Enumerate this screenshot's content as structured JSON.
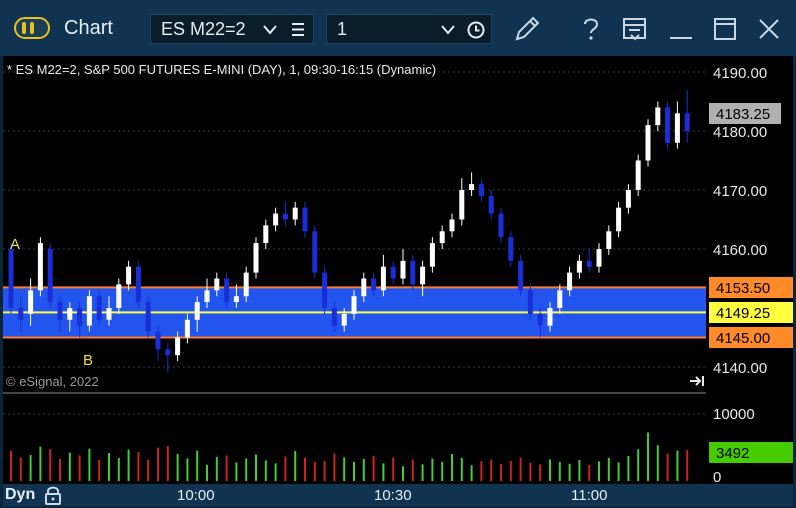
{
  "titlebar": {
    "title": "Chart",
    "symbol": "ES M22=2",
    "interval": "1",
    "icons": [
      "toggle-icon",
      "chevron-down-icon",
      "menu-icon",
      "chevron-down-icon",
      "clock-icon",
      "pencil-icon",
      "help-icon",
      "layout-icon",
      "minimize-icon",
      "maximize-icon",
      "close-icon"
    ],
    "accent_color": "#e8c020"
  },
  "chart": {
    "header": "* ES M22=2, S&P 500 FUTURES E-MINI (DAY), 1, 09:30-16:15 (Dynamic)",
    "copyright": "© eSignal, 2022",
    "annotation_a": "A",
    "annotation_b": "B",
    "price_axis": {
      "labels": [
        "4190.00",
        "4180.00",
        "4170.00",
        "4160.00",
        "4140.00"
      ],
      "last_price": "4183.25",
      "band_top": "4153.50",
      "band_mid": "4149.25",
      "band_bottom": "4145.00"
    },
    "volume_axis": {
      "labels": [
        "10000",
        "0"
      ],
      "last_volume": "3492"
    },
    "colors": {
      "up": "#ffffff",
      "down": "#1a2ed8",
      "band_fill": "#2255ee",
      "band_edge": "#ff7a2a",
      "mid_line": "#ffff40",
      "vol_up": "#44cc33",
      "vol_down": "#cc2222"
    }
  },
  "bottom": {
    "mode": "Dyn",
    "times": [
      "10:00",
      "10:30",
      "11:00"
    ]
  },
  "chart_data": {
    "type": "candlestick",
    "title": "* ES M22=2, S&P 500 FUTURES E-MINI (DAY), 1, 09:30-16:15 (Dynamic)",
    "y_ticks": [
      4140,
      4160,
      4170,
      4180,
      4190
    ],
    "x_ticks": [
      "10:00",
      "10:30",
      "11:00"
    ],
    "band": [
      4145.0,
      4149.25,
      4153.5
    ],
    "last": 4183.25,
    "last_volume": 3492,
    "series": [
      {
        "name": "price",
        "points": [
          [
            4160,
            4150,
            4161,
            4149
          ],
          [
            4150,
            4148,
            4152,
            4146
          ],
          [
            4149,
            4153,
            4155,
            4147
          ],
          [
            4153,
            4161,
            4162,
            4152
          ],
          [
            4160,
            4151,
            4161,
            4150
          ],
          [
            4151,
            4148,
            4152,
            4146
          ],
          [
            4148,
            4150,
            4151,
            4146
          ],
          [
            4150,
            4147,
            4151,
            4145
          ],
          [
            4147,
            4152,
            4153,
            4146
          ],
          [
            4152,
            4148,
            4153,
            4147
          ],
          [
            4148,
            4150,
            4152,
            4147
          ],
          [
            4150,
            4154,
            4155,
            4149
          ],
          [
            4154,
            4157,
            4158,
            4153
          ],
          [
            4157,
            4151,
            4158,
            4150
          ],
          [
            4151,
            4146,
            4152,
            4145
          ],
          [
            4146,
            4143,
            4147,
            4141
          ],
          [
            4143,
            4142,
            4144,
            4139
          ],
          [
            4142,
            4145,
            4146,
            4141
          ],
          [
            4145,
            4148,
            4149,
            4144
          ],
          [
            4148,
            4151,
            4152,
            4146
          ],
          [
            4151,
            4153,
            4155,
            4150
          ],
          [
            4153,
            4155,
            4156,
            4152
          ],
          [
            4155,
            4151,
            4156,
            4150
          ],
          [
            4151,
            4152,
            4154,
            4150
          ],
          [
            4152,
            4156,
            4157,
            4151
          ],
          [
            4156,
            4161,
            4162,
            4155
          ],
          [
            4161,
            4164,
            4165,
            4160
          ],
          [
            4164,
            4166,
            4167,
            4163
          ],
          [
            4166,
            4165,
            4168,
            4164
          ],
          [
            4165,
            4167,
            4168,
            4164
          ],
          [
            4167,
            4163,
            4168,
            4162
          ],
          [
            4163,
            4156,
            4164,
            4155
          ],
          [
            4156,
            4150,
            4157,
            4149
          ],
          [
            4150,
            4147,
            4151,
            4146
          ],
          [
            4147,
            4149,
            4150,
            4146
          ],
          [
            4149,
            4152,
            4153,
            4148
          ],
          [
            4152,
            4155,
            4156,
            4151
          ],
          [
            4155,
            4153,
            4156,
            4152
          ],
          [
            4153,
            4157,
            4159,
            4152
          ],
          [
            4157,
            4155,
            4158,
            4154
          ],
          [
            4155,
            4158,
            4160,
            4154
          ],
          [
            4158,
            4154,
            4159,
            4153
          ],
          [
            4154,
            4157,
            4158,
            4152
          ],
          [
            4157,
            4161,
            4162,
            4156
          ],
          [
            4161,
            4163,
            4164,
            4160
          ],
          [
            4163,
            4165,
            4166,
            4162
          ],
          [
            4165,
            4170,
            4172,
            4164
          ],
          [
            4170,
            4171,
            4173,
            4169
          ],
          [
            4171,
            4169,
            4172,
            4168
          ],
          [
            4169,
            4166,
            4170,
            4165
          ],
          [
            4166,
            4162,
            4167,
            4161
          ],
          [
            4162,
            4158,
            4163,
            4157
          ],
          [
            4158,
            4153,
            4159,
            4152
          ],
          [
            4153,
            4149,
            4154,
            4148
          ],
          [
            4149,
            4147,
            4150,
            4145
          ],
          [
            4147,
            4150,
            4151,
            4146
          ],
          [
            4150,
            4153,
            4154,
            4149
          ],
          [
            4153,
            4156,
            4157,
            4152
          ],
          [
            4156,
            4158,
            4159,
            4155
          ],
          [
            4158,
            4157,
            4160,
            4156
          ],
          [
            4157,
            4160,
            4161,
            4156
          ],
          [
            4160,
            4163,
            4164,
            4159
          ],
          [
            4163,
            4167,
            4168,
            4162
          ],
          [
            4167,
            4170,
            4171,
            4166
          ],
          [
            4170,
            4175,
            4176,
            4169
          ],
          [
            4175,
            4181,
            4182,
            4174
          ],
          [
            4181,
            4184,
            4185,
            4180
          ],
          [
            4184,
            4178,
            4185,
            4177
          ],
          [
            4178,
            4183,
            4185,
            4177
          ],
          [
            4183,
            4180,
            4187,
            4178
          ]
        ]
      },
      {
        "name": "volume",
        "values": [
          6200,
          4800,
          5300,
          7000,
          6500,
          4500,
          5800,
          5200,
          6600,
          4300,
          5700,
          4700,
          6400,
          5900,
          4300,
          6800,
          7100,
          5500,
          4600,
          6200,
          3300,
          4900,
          5200,
          3800,
          4600,
          5400,
          4200,
          3600,
          5000,
          6100,
          4700,
          3900,
          4100,
          5600,
          4800,
          3900,
          4500,
          5100,
          3600,
          4800,
          3000,
          4400,
          3400,
          4600,
          3900,
          5500,
          4700,
          3200,
          4000,
          4400,
          3500,
          4100,
          4800,
          3700,
          3400,
          4400,
          3900,
          3500,
          4300,
          3300,
          4000,
          4700,
          3800,
          5100,
          6500,
          9900,
          7300,
          5600,
          6200,
          6300
        ]
      }
    ]
  }
}
